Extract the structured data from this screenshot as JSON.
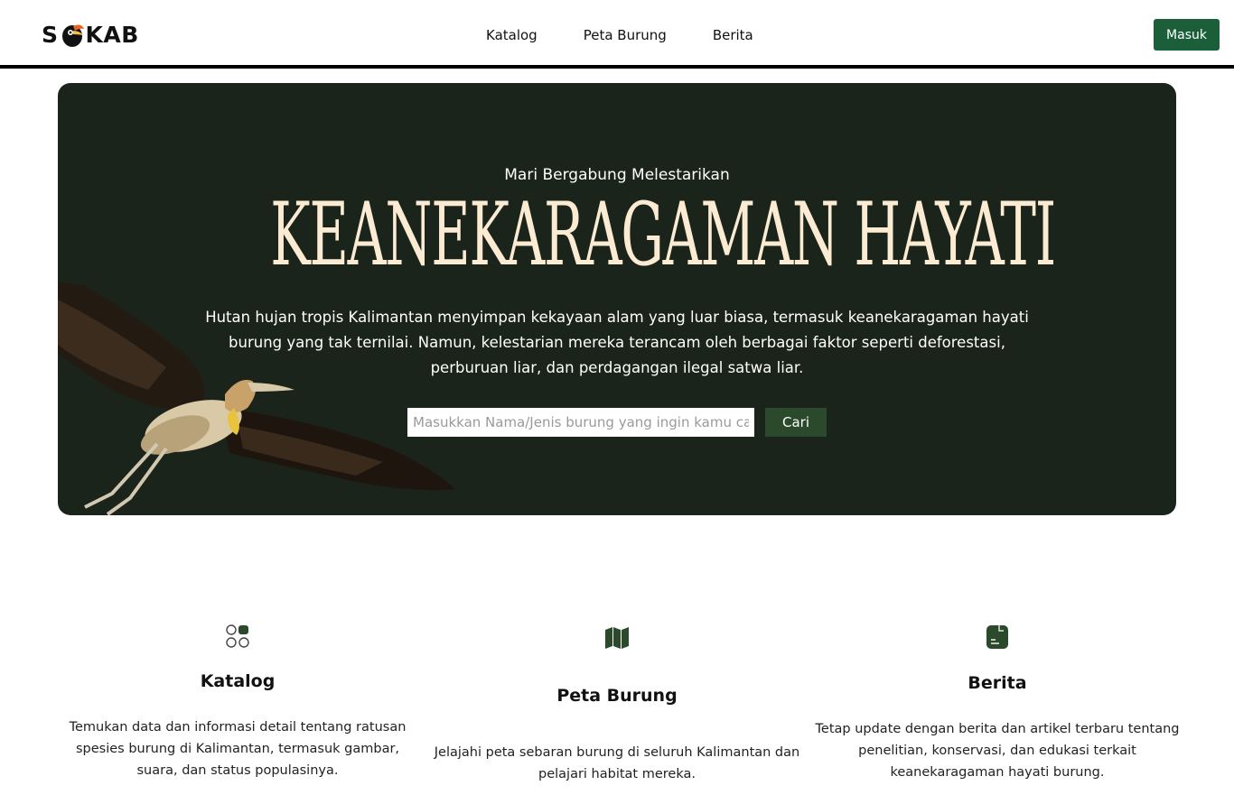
{
  "header": {
    "logo_text_left": "S",
    "logo_text_right": "KAB",
    "nav": [
      {
        "label": "Katalog"
      },
      {
        "label": "Peta Burung"
      },
      {
        "label": "Berita"
      }
    ],
    "login_label": "Masuk"
  },
  "hero": {
    "subtitle": "Mari Bergabung Melestarikan",
    "title": "KEANEKARAGAMAN HAYATI",
    "description": "Hutan hujan tropis Kalimantan menyimpan kekayaan alam yang luar biasa, termasuk keanekaragaman hayati burung yang tak ternilai. Namun, kelestarian mereka terancam oleh berbagai faktor seperti deforestasi, perburuan liar, dan perdagangan ilegal satwa liar.",
    "search_placeholder": "Masukkan Nama/Jenis burung yang ingin kamu cari",
    "search_value": "",
    "search_button": "Cari"
  },
  "features": [
    {
      "icon": "catalog-grid-icon",
      "title": "Katalog",
      "text": "Temukan data dan informasi detail tentang ratusan spesies burung di Kalimantan, termasuk gambar, suara, dan status populasinya."
    },
    {
      "icon": "map-icon",
      "title": "Peta Burung",
      "text": "Jelajahi peta sebaran burung di seluruh Kalimantan dan pelajari habitat mereka."
    },
    {
      "icon": "news-icon",
      "title": "Berita",
      "text": "Tetap update dengan berita dan artikel terbaru tentang penelitian, konservasi, dan edukasi terkait keanekaragaman hayati burung."
    }
  ],
  "colors": {
    "primary_green": "#1b5e3a",
    "hero_bg": "#1b241a",
    "hero_title": "#fcebd3",
    "icon_green": "#2a4a2b"
  }
}
